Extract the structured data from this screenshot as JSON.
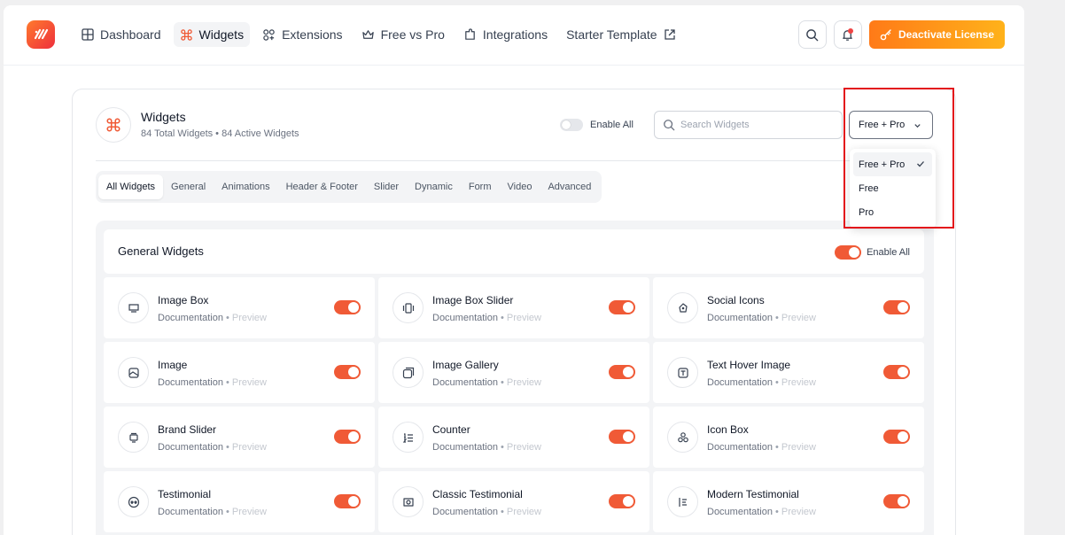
{
  "nav": {
    "items": [
      {
        "label": "Dashboard",
        "icon": "grid-icon",
        "active": false
      },
      {
        "label": "Widgets",
        "icon": "command-icon",
        "active": true
      },
      {
        "label": "Extensions",
        "icon": "extensions-icon",
        "active": false
      },
      {
        "label": "Free vs Pro",
        "icon": "crown-icon",
        "active": false
      },
      {
        "label": "Integrations",
        "icon": "plugin-icon",
        "active": false
      },
      {
        "label": "Starter Template",
        "icon": "external-link-icon",
        "active": false
      }
    ]
  },
  "topbar": {
    "license_label": "Deactivate License",
    "accent": "#ff7a18"
  },
  "header": {
    "title": "Widgets",
    "subtitle": "84 Total Widgets • 84 Active Widgets",
    "enable_all_label": "Enable All",
    "search_placeholder": "Search Widgets",
    "filter_value": "Free + Pro"
  },
  "tabs": [
    "All Widgets",
    "General",
    "Animations",
    "Header & Footer",
    "Slider",
    "Dynamic",
    "Form",
    "Video",
    "Advanced"
  ],
  "dropdown": {
    "options": [
      "Free + Pro",
      "Free",
      "Pro"
    ],
    "selected": "Free + Pro"
  },
  "panel": {
    "title": "General Widgets",
    "enable_all_label": "Enable All"
  },
  "widget_link_doc": "Documentation",
  "widget_link_sep": "•",
  "widget_link_preview": "Preview",
  "widgets": [
    {
      "name": "Image Box",
      "icon": "image-box-icon",
      "enabled": true
    },
    {
      "name": "Image Box Slider",
      "icon": "slider-icon",
      "enabled": true
    },
    {
      "name": "Social Icons",
      "icon": "social-icon",
      "enabled": true
    },
    {
      "name": "Image",
      "icon": "image-icon",
      "enabled": true
    },
    {
      "name": "Image Gallery",
      "icon": "gallery-icon",
      "enabled": true
    },
    {
      "name": "Text Hover Image",
      "icon": "text-hover-icon",
      "enabled": true
    },
    {
      "name": "Brand Slider",
      "icon": "brand-slider-icon",
      "enabled": true
    },
    {
      "name": "Counter",
      "icon": "counter-icon",
      "enabled": true
    },
    {
      "name": "Icon Box",
      "icon": "icon-box-icon",
      "enabled": true
    },
    {
      "name": "Testimonial",
      "icon": "testimonial-icon",
      "enabled": true
    },
    {
      "name": "Classic Testimonial",
      "icon": "classic-testimonial-icon",
      "enabled": true
    },
    {
      "name": "Modern Testimonial",
      "icon": "modern-testimonial-icon",
      "enabled": true
    }
  ],
  "colors": {
    "toggle_on": "#f05a36",
    "highlight_box": "#e3131b"
  }
}
